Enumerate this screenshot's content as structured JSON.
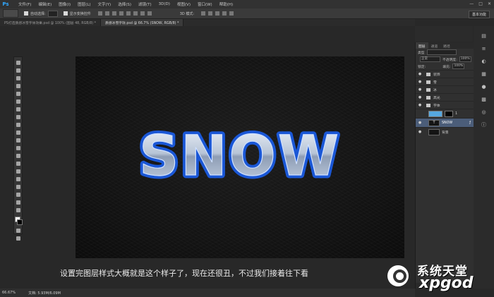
{
  "app": {
    "logo": "Ps"
  },
  "menu": [
    "文件(F)",
    "编辑(E)",
    "图像(I)",
    "图层(L)",
    "文字(Y)",
    "选择(S)",
    "滤镜(T)",
    "3D(D)",
    "视图(V)",
    "窗口(W)",
    "帮助(H)"
  ],
  "window_controls": [
    "—",
    "□",
    "✕"
  ],
  "options": {
    "auto_select_label": "自动选择:",
    "transform_label": "显示变换控件",
    "mode_label": "3D 模式:",
    "workspace": "基本功能"
  },
  "tabs": [
    {
      "label": "PS打造质感冰雪字体效果.psd @ 100% (图层 48, RGB/8) *"
    },
    {
      "label": "质感冰雪字效.psd @ 66.7% (SNOW, RGB/8) *"
    }
  ],
  "canvas": {
    "text": "SNOW"
  },
  "subtitle": "设置完图层样式大概就是这个样子了，现在还很丑，不过我们接着往下看",
  "status": {
    "zoom": "66.67%",
    "doc": "文档: 5.93M/6.09M"
  },
  "layers_panel": {
    "tabs": [
      "图层",
      "通道",
      "路径"
    ],
    "filter_label": "类型",
    "blend_mode": "正常",
    "opacity_label": "不透明度:",
    "opacity_value": "100%",
    "lock_label": "锁定:",
    "fill_label": "填充:",
    "fill_value": "100%",
    "layers": [
      {
        "name": "装饰",
        "type": "group"
      },
      {
        "name": "雪",
        "type": "group"
      },
      {
        "name": "冰",
        "type": "group"
      },
      {
        "name": "高光",
        "type": "group"
      },
      {
        "name": "字体",
        "type": "group"
      },
      {
        "name": "1",
        "type": "layer"
      },
      {
        "name": "SNOW",
        "type": "text",
        "selected": true
      },
      {
        "name": "背景",
        "type": "layer"
      }
    ]
  },
  "right_icons": [
    "history-icon",
    "properties-icon",
    "adjustments-icon",
    "styles-icon",
    "color-icon",
    "swatches-icon",
    "navigator-icon",
    "info-icon"
  ],
  "watermark": {
    "top": "系统天堂",
    "bottom": "xpgod"
  }
}
